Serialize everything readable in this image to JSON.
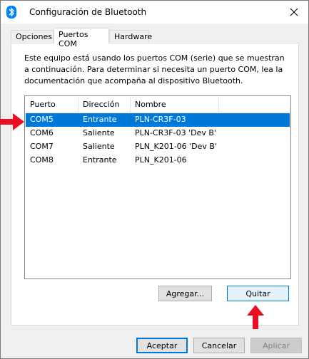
{
  "window": {
    "title": "Configuración de Bluetooth"
  },
  "tabs": [
    {
      "label": "Opciones"
    },
    {
      "label": "Puertos COM"
    },
    {
      "label": "Hardware"
    }
  ],
  "description": "Este equipo está usando los puertos COM (serie) que se muestran a continuación. Para determinar si necesita un puerto COM, lea la documentación que acompaña al dispositivo Bluetooth.",
  "table": {
    "columns": [
      "Puerto",
      "Dirección",
      "Nombre"
    ],
    "rows": [
      {
        "puerto": "COM5",
        "direccion": "Entrante",
        "nombre": "PLN-CR3F-03"
      },
      {
        "puerto": "COM6",
        "direccion": "Saliente",
        "nombre": "PLN-CR3F-03 'Dev B'"
      },
      {
        "puerto": "COM7",
        "direccion": "Saliente",
        "nombre": "PLN_K201-06 'Dev B'"
      },
      {
        "puerto": "COM8",
        "direccion": "Entrante",
        "nombre": "PLN_K201-06"
      }
    ],
    "selected_row": 0
  },
  "buttons": {
    "add": "Agregar...",
    "remove": "Quitar",
    "ok": "Aceptar",
    "cancel": "Cancelar",
    "apply": "Aplicar"
  },
  "colors": {
    "selection": "#0078d7",
    "annotation_arrow": "#e81123",
    "bluetooth_icon": "#0082fc"
  },
  "icons": [
    "bluetooth-icon",
    "close-icon",
    "arrow-right-annotation",
    "arrow-up-annotation"
  ]
}
